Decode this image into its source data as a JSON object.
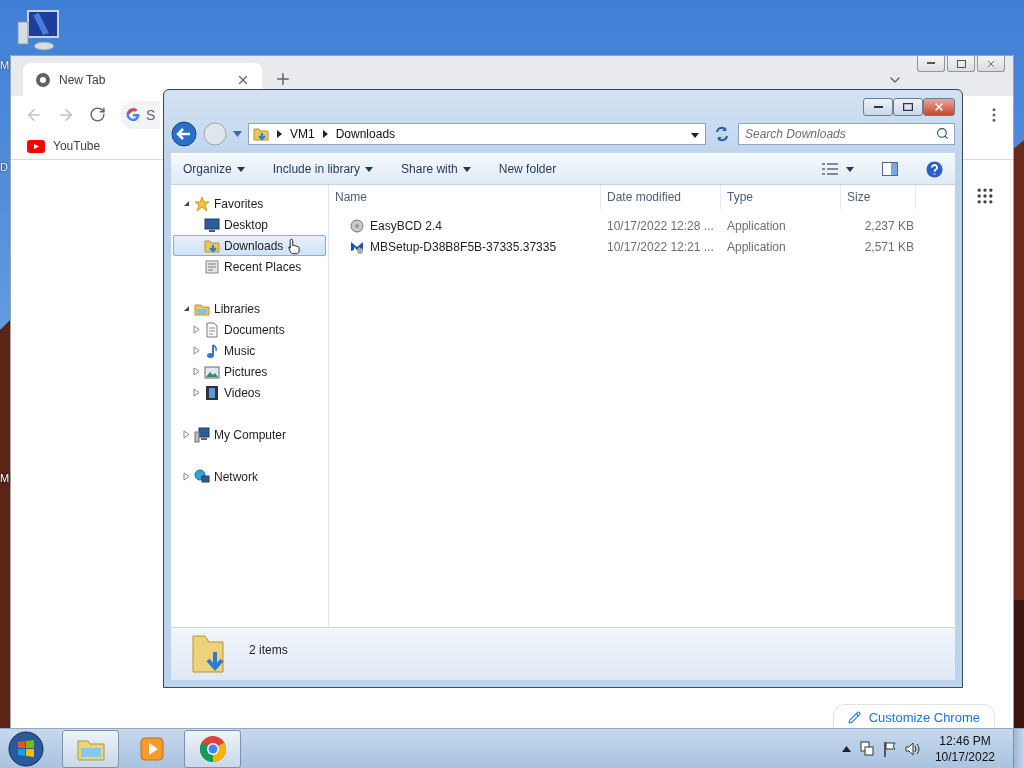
{
  "desktop": {
    "icons": [
      {
        "label": "M"
      },
      {
        "label": "D"
      },
      {
        "label": "M"
      }
    ]
  },
  "chrome": {
    "tabs": [
      {
        "title": "New Tab",
        "selected": true
      }
    ],
    "omnibox": {
      "placeholder": "S"
    },
    "bookmarks": [
      {
        "label": "YouTube"
      }
    ],
    "customize_button": "Customize Chrome"
  },
  "explorer": {
    "breadcrumb": [
      "VM1",
      "Downloads"
    ],
    "search": {
      "placeholder": "Search Downloads"
    },
    "toolbar": [
      {
        "label": "Organize",
        "dropdown": true
      },
      {
        "label": "Include in library",
        "dropdown": true
      },
      {
        "label": "Share with",
        "dropdown": true
      },
      {
        "label": "New folder",
        "dropdown": false
      }
    ],
    "nav": [
      {
        "label": "Favorites",
        "kind": "star",
        "expanded": true,
        "selected": false,
        "children": [
          {
            "label": "Desktop",
            "kind": "desktop",
            "selected": false
          },
          {
            "label": "Downloads",
            "kind": "downloads",
            "selected": true
          },
          {
            "label": "Recent Places",
            "kind": "recent",
            "selected": false
          }
        ]
      },
      {
        "label": "Libraries",
        "kind": "library",
        "expanded": true,
        "selected": false,
        "children": [
          {
            "label": "Documents",
            "kind": "documents",
            "expanded": false,
            "selected": false
          },
          {
            "label": "Music",
            "kind": "music",
            "expanded": false,
            "selected": false
          },
          {
            "label": "Pictures",
            "kind": "pictures",
            "expanded": false,
            "selected": false
          },
          {
            "label": "Videos",
            "kind": "videos",
            "expanded": false,
            "selected": false
          }
        ]
      },
      {
        "label": "My Computer",
        "kind": "computer",
        "expanded": false,
        "selected": false
      },
      {
        "label": "Network",
        "kind": "network",
        "expanded": false,
        "selected": false
      }
    ],
    "columns": [
      "Name",
      "Date modified",
      "Type",
      "Size"
    ],
    "files": [
      {
        "name": "EasyBCD 2.4",
        "kind": "installer",
        "date": "10/17/2022 12:28 ...",
        "type": "Application",
        "size": "2,237 KB"
      },
      {
        "name": "MBSetup-D38B8F5B-37335.37335",
        "kind": "setup",
        "date": "10/17/2022 12:21 ...",
        "type": "Application",
        "size": "2,571 KB"
      }
    ],
    "status": "2 items"
  },
  "taskbar": {
    "apps": [
      {
        "kind": "explorer",
        "running": true
      },
      {
        "kind": "media",
        "running": false
      },
      {
        "kind": "chrome",
        "running": true
      }
    ],
    "clock": {
      "time": "12:46 PM",
      "date": "10/17/2022"
    }
  }
}
